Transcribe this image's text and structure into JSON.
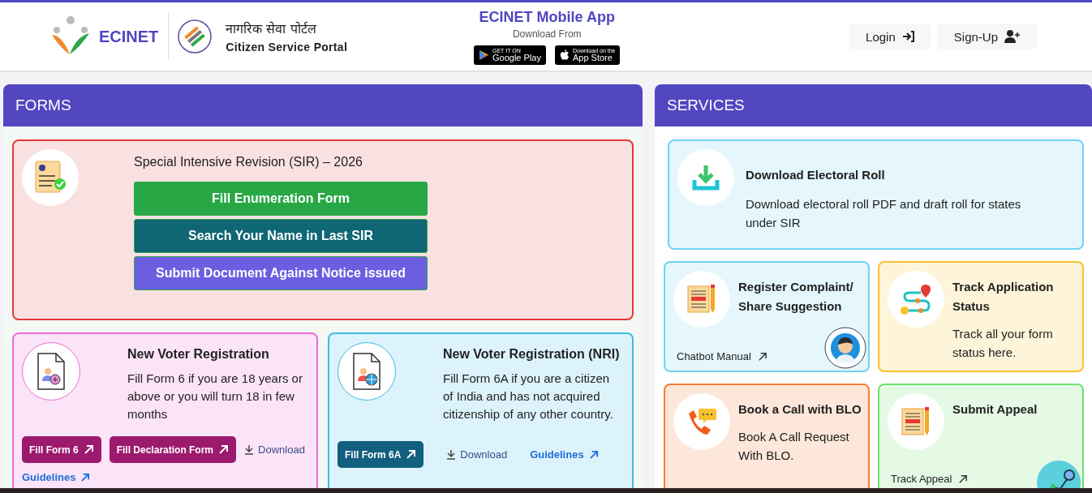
{
  "header": {
    "brand": "ECINET",
    "portal_title_hindi": "नागरिक सेवा पोर्टल",
    "portal_title": "Citizen Service Portal",
    "app": {
      "title": "ECINET Mobile App",
      "subtitle": "Download From",
      "stores": [
        {
          "kind": "google",
          "small": "GET IT ON",
          "big": "Google Play"
        },
        {
          "kind": "apple",
          "small": "Download on the",
          "big": "App Store"
        }
      ]
    },
    "buttons": [
      {
        "kind": "login",
        "label": "Login"
      },
      {
        "kind": "signup",
        "label": "Sign-Up"
      }
    ]
  },
  "forms": {
    "title": "FORMS",
    "sir": {
      "title": "Special Intensive Revision (SIR) – 2026",
      "buttons": [
        {
          "label": "Fill Enumeration Form",
          "color": "#28a745"
        },
        {
          "label": "Search Your Name in Last SIR",
          "color": "#0f6674"
        },
        {
          "label": "Submit Document Against Notice issued",
          "color": "#6c5ee0"
        }
      ]
    },
    "cards": [
      {
        "kind": "form6",
        "color": "#f06ad6",
        "title": "New Voter Registration",
        "text": "Fill Form 6 if you are 18 years or above or you will turn 18 in few months",
        "actions": [
          {
            "kind": "button",
            "label": "Fill Form 6",
            "color": "#9c1a6e"
          },
          {
            "kind": "button",
            "label": "Fill Declaration Form",
            "color": "#9c1a6e"
          },
          {
            "kind": "download",
            "label": "Download"
          },
          {
            "kind": "guidelines",
            "label": "Guidelines"
          }
        ]
      },
      {
        "kind": "form6a",
        "color": "#3bbde6",
        "title": "New Voter Registration (NRI)",
        "text": "Fill Form 6A if you are a citizen of India and has not acquired citizenship of any other country.",
        "actions": [
          {
            "kind": "button",
            "label": "Fill Form 6A",
            "color": "#135f80"
          },
          {
            "kind": "download",
            "label": "Download"
          },
          {
            "kind": "guidelines",
            "label": "Guidelines"
          }
        ]
      }
    ]
  },
  "services": {
    "title": "SERVICES",
    "cards": [
      {
        "kind": "download",
        "color": "#6fd3f5",
        "title": "Download Electoral Roll",
        "text": "Download electoral roll PDF and draft roll for states under SIR"
      },
      {
        "kind": "complaint",
        "color": "#6fd3f5",
        "title": "Register Complaint/ Share Suggestion",
        "link": "Chatbot Manual"
      },
      {
        "kind": "track",
        "color": "#fbc02d",
        "title": "Track Application Status",
        "text": "Track all your form status here."
      },
      {
        "kind": "call",
        "color": "#f57c33",
        "title": "Book a Call with BLO",
        "text": "Book A Call Request With BLO."
      },
      {
        "kind": "appeal",
        "color": "#69e36f",
        "title": "Submit Appeal",
        "link": "Track Appeal"
      }
    ]
  }
}
